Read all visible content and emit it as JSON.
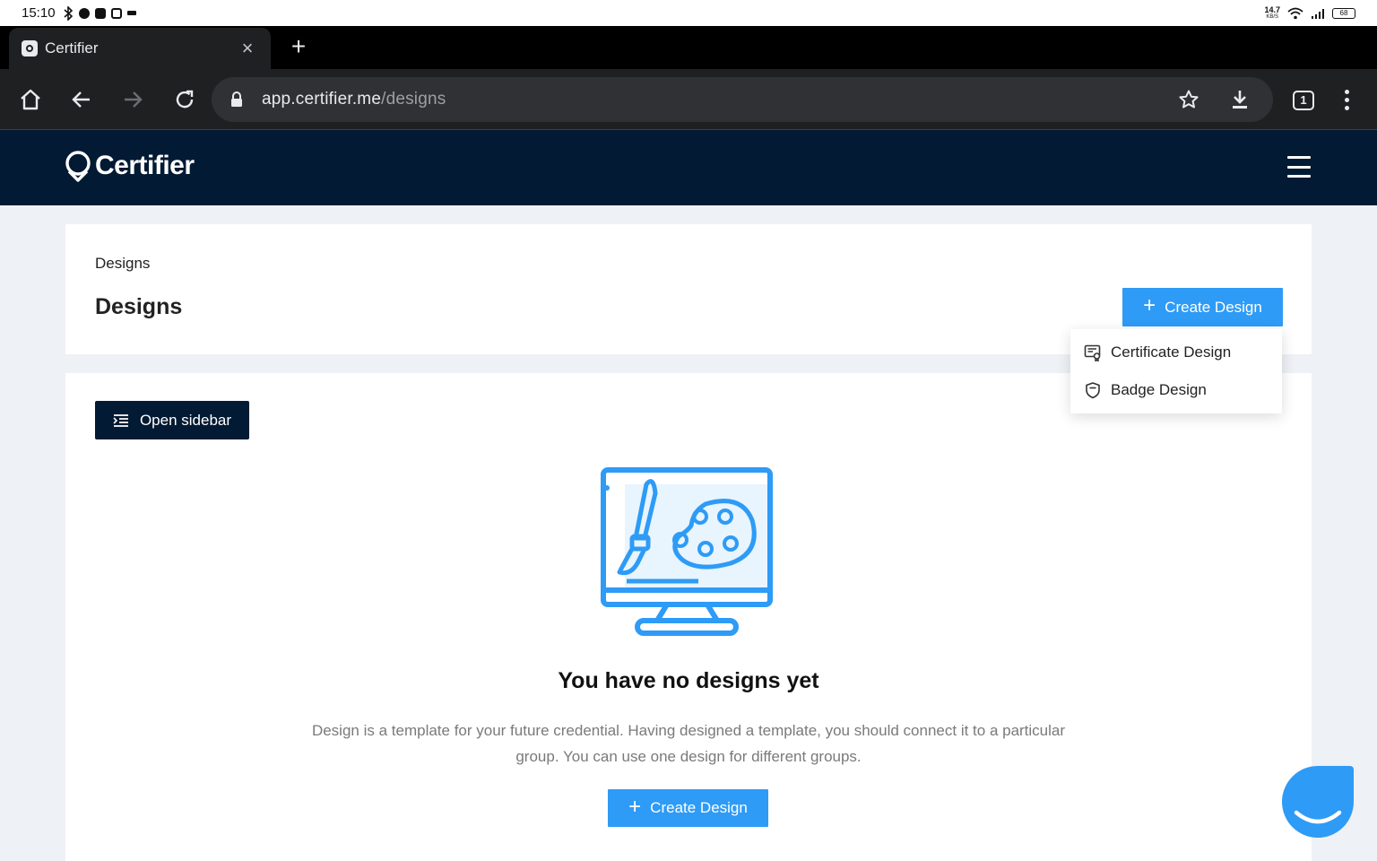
{
  "status_bar": {
    "time": "15:10",
    "net_speed_top": "14.7",
    "net_speed_bottom": "KB/S",
    "battery": "68"
  },
  "browser": {
    "tab_title": "Certifier",
    "url_host": "app.certifier.me",
    "url_path": "/designs",
    "tab_count": "1"
  },
  "app": {
    "brand": "Certifier"
  },
  "page": {
    "breadcrumb": "Designs",
    "title": "Designs",
    "create_button": "Create Design",
    "open_sidebar": "Open sidebar",
    "empty_title": "You have no designs yet",
    "empty_description": "Design is a template for your future credential. Having designed a template, you should connect it to a particular group. You can use one design for different groups.",
    "empty_create_button": "Create Design"
  },
  "dropdown": {
    "items": [
      {
        "label": "Certificate Design",
        "icon": "certificate-icon"
      },
      {
        "label": "Badge Design",
        "icon": "shield-icon"
      }
    ]
  },
  "colors": {
    "accent": "#2e9bf6",
    "navy": "#021a33",
    "page_bg": "#eef1f5"
  }
}
